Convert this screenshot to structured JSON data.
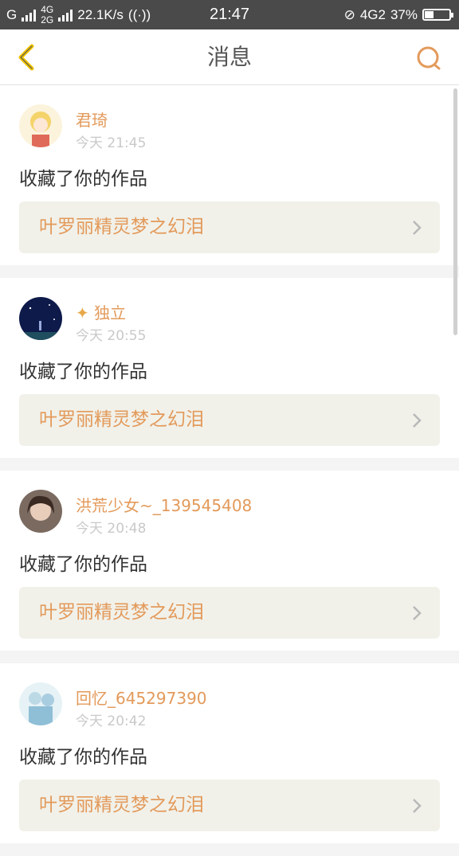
{
  "status_bar": {
    "carrier": "G",
    "net_top": "4G",
    "net_bottom": "2G",
    "speed": "22.1K/s",
    "time": "21:47",
    "signal2": "4G2",
    "battery": "37%",
    "battery_level": 0.37
  },
  "header": {
    "title": "消息"
  },
  "messages": [
    {
      "name": "君琦",
      "time": "今天 21:45",
      "action": "收藏了你的作品",
      "work": "叶罗丽精灵梦之幻泪",
      "has_badge": false
    },
    {
      "name": "独立",
      "time": "今天 20:55",
      "action": "收藏了你的作品",
      "work": "叶罗丽精灵梦之幻泪",
      "has_badge": true
    },
    {
      "name": "洪荒少女~_139545408",
      "time": "今天 20:48",
      "action": "收藏了你的作品",
      "work": "叶罗丽精灵梦之幻泪",
      "has_badge": false
    },
    {
      "name": "回忆_645297390",
      "time": "今天 20:42",
      "action": "收藏了你的作品",
      "work": "叶罗丽精灵梦之幻泪",
      "has_badge": false
    }
  ],
  "colors": {
    "accent": "#e39a5b",
    "back_icon": "#f0c400",
    "card_link_bg": "#f1f1ea"
  }
}
